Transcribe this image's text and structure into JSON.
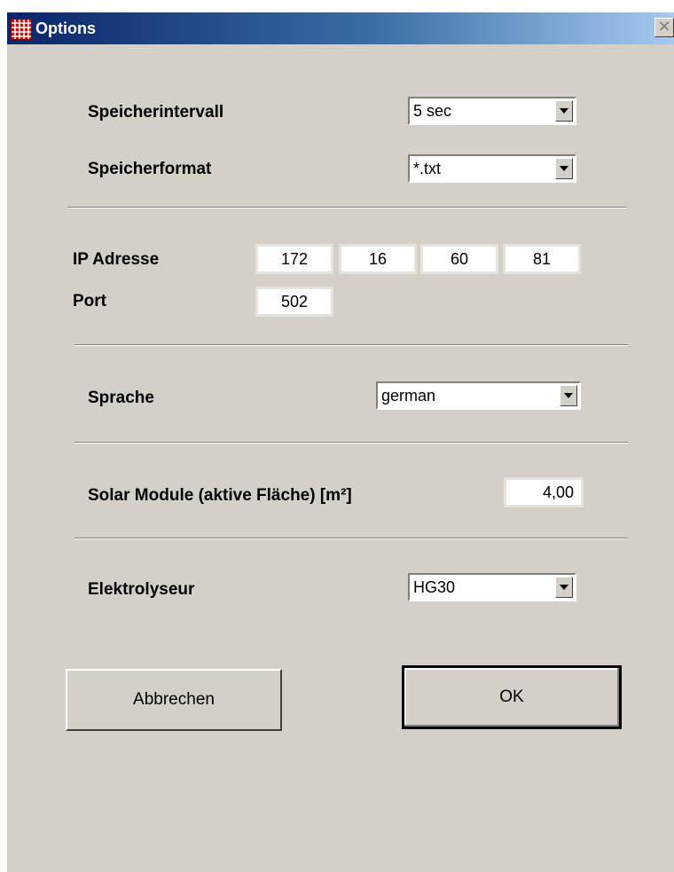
{
  "window": {
    "title": "Options",
    "close_glyph": "✕",
    "icon": "app-grid-icon"
  },
  "speicherintervall": {
    "label": "Speicherintervall",
    "value": "5 sec"
  },
  "speicherformat": {
    "label": "Speicherformat",
    "value": "*.txt"
  },
  "network": {
    "ip_label": "IP Adresse",
    "ip": [
      "172",
      "16",
      "60",
      "81"
    ],
    "port_label": "Port",
    "port": "502"
  },
  "sprache": {
    "label": "Sprache",
    "value": "german"
  },
  "solar": {
    "label": "Solar Module (aktive Fläche) [m²]",
    "value": "4,00"
  },
  "elektrolyseur": {
    "label": "Elektrolyseur",
    "value": "HG30"
  },
  "buttons": {
    "cancel": "Abbrechen",
    "ok": "OK"
  }
}
